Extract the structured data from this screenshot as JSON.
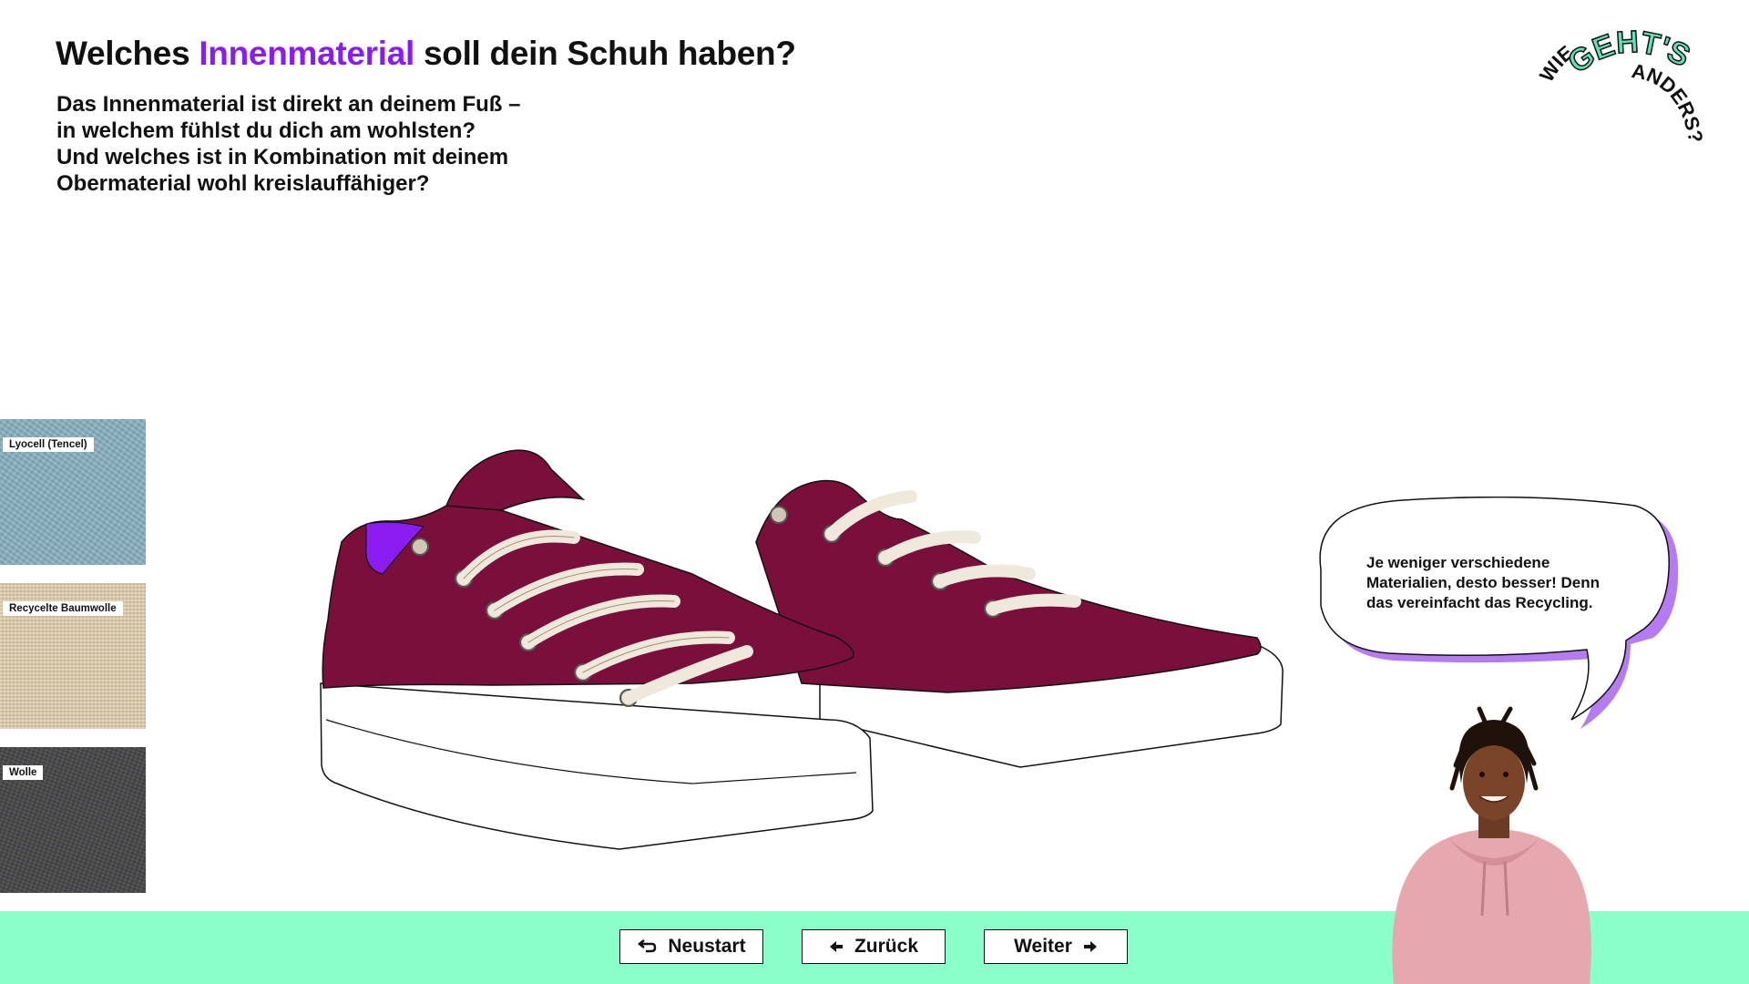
{
  "header": {
    "title_pre": "Welches ",
    "title_accent": "Innenmaterial",
    "title_post": " soll dein Schuh haben?",
    "intro_lines": [
      "Das Innenmaterial ist direkt an deinem Fuß –",
      "in welchem fühlst du dich am wohlsten?",
      "Und welches ist in Kombination mit deinem",
      "Obermaterial wohl kreislauffähiger?"
    ]
  },
  "logo": {
    "word1": "WIE",
    "word2": "GEHT'S",
    "word3": "ANDERS?"
  },
  "materials": [
    {
      "label": "Lyocell (Tencel)"
    },
    {
      "label": "Recycelte Baumwolle"
    },
    {
      "label": "Wolle"
    }
  ],
  "speech_bubble": {
    "text_lines": [
      "Je weniger verschiedene",
      "Materialien, desto besser! Denn",
      "das vereinfacht das Recycling."
    ]
  },
  "nav": {
    "restart_label": "Neustart",
    "back_label": "Zurück",
    "next_label": "Weiter"
  },
  "colors": {
    "accent": "#8a1cf2",
    "footer": "#8affc9",
    "shoe_upper": "#7a0f3c",
    "shoe_lining": "#8a1cf2",
    "laces": "#efe9db",
    "logo_green": "#5fe3b2"
  },
  "icons": {
    "restart": "return-arrow-icon",
    "back": "arrow-left-icon",
    "next": "arrow-right-icon"
  }
}
